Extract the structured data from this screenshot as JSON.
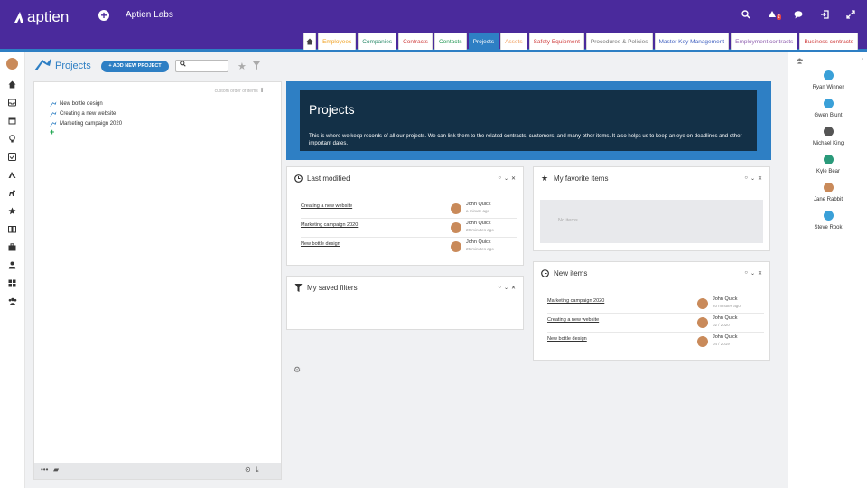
{
  "app": {
    "logo_text": "aptien",
    "org_name": "Aptien Labs",
    "notification_count": "1"
  },
  "tabs": [
    {
      "label": "Employees",
      "color": "#f0a020"
    },
    {
      "label": "Companies",
      "color": "#2a8a6a"
    },
    {
      "label": "Contracts",
      "color": "#d04040"
    },
    {
      "label": "Contacts",
      "color": "#2a9a5a"
    },
    {
      "label": "Projects",
      "color": "#ffffff",
      "active": true
    },
    {
      "label": "Assets",
      "color": "#f0a060"
    },
    {
      "label": "Safety Equipment",
      "color": "#d04040"
    },
    {
      "label": "Procedures & Policies",
      "color": "#777777"
    },
    {
      "label": "Master Key Management",
      "color": "#4060c0"
    },
    {
      "label": "Employment contracts",
      "color": "#9060b0"
    },
    {
      "label": "Business contracts",
      "color": "#d04040"
    }
  ],
  "page": {
    "title": "Projects",
    "add_button": "+ ADD NEW PROJECT",
    "custom_order": "custom order of items"
  },
  "tree": {
    "items": [
      "New bottle design",
      "Creating a new website",
      "Marketing campaign 2020"
    ]
  },
  "banner": {
    "title": "Projects",
    "description": "This is where we keep records of all our projects. We can link them to the related contracts, customers, and many other items. It also helps us to keep an eye on deadlines and other important dates."
  },
  "last_modified": {
    "title": "Last modified",
    "rows": [
      {
        "name": "Creating a new website",
        "user": "John Quick",
        "time": "a minute ago"
      },
      {
        "name": "Marketing campaign 2020",
        "user": "John Quick",
        "time": "20 minutes ago"
      },
      {
        "name": "New bottle design",
        "user": "John Quick",
        "time": "25 minutes ago"
      }
    ]
  },
  "favorites": {
    "title": "My favorite items",
    "empty": "No items"
  },
  "saved_filters": {
    "title": "My saved filters"
  },
  "new_items": {
    "title": "New items",
    "rows": [
      {
        "name": "Marketing campaign 2020",
        "user": "John Quick",
        "time": "20 minutes ago"
      },
      {
        "name": "Creating a new website",
        "user": "John Quick",
        "time": "02 / 2020"
      },
      {
        "name": "New bottle design",
        "user": "John Quick",
        "time": "04 / 2019"
      }
    ]
  },
  "users": [
    {
      "name": "Ryan Winner",
      "color": "#3aa0d8"
    },
    {
      "name": "Gwen Blunt",
      "color": "#3aa0d8"
    },
    {
      "name": "Michael King",
      "color": "#555555"
    },
    {
      "name": "Kyle Bear",
      "color": "#2a9a7a"
    },
    {
      "name": "Jane Rabbit",
      "color": "#c98a5a"
    },
    {
      "name": "Steve Rook",
      "color": "#3aa0d8"
    }
  ]
}
